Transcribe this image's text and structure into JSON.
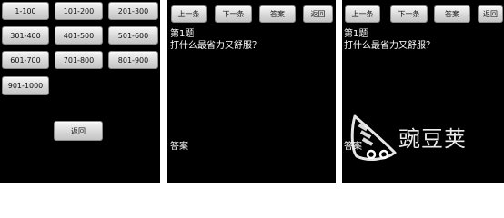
{
  "range_menu": {
    "ranges": [
      "1-100",
      "101-200",
      "201-300",
      "301-400",
      "401-500",
      "501-600",
      "601-700",
      "701-800",
      "801-900",
      "901-1000"
    ],
    "back_label": "返回"
  },
  "question_screen": {
    "prev_label": "上一条",
    "next_label": "下一条",
    "answer_label": "答案",
    "back_label": "返回",
    "question_number": "第1题",
    "question_text": "打什么最省力又舒服？",
    "answer_caption": "答案"
  },
  "watermark": {
    "icon": "wandoujia-logo-icon",
    "text": "豌豆荚"
  },
  "colors": {
    "screen_bg": "#000000",
    "text": "#ffffff",
    "button_bg": "#dcdcdc"
  }
}
